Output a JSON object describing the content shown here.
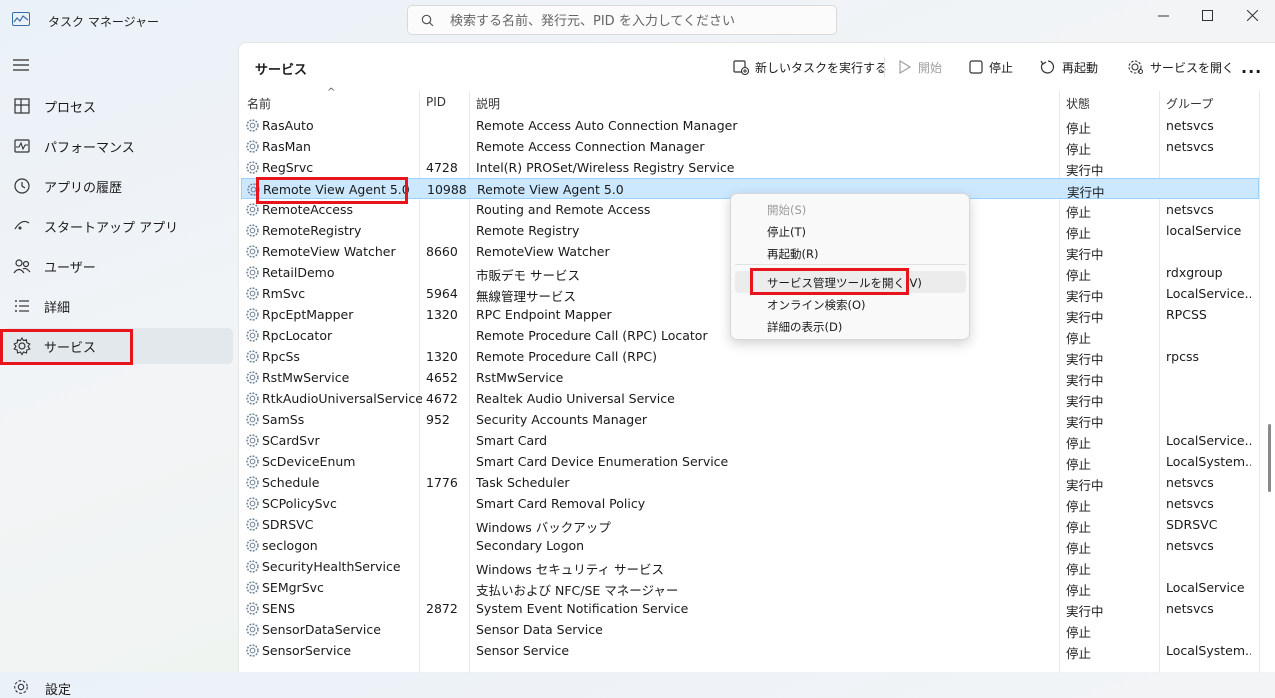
{
  "window": {
    "title": "タスク マネージャー",
    "search_placeholder": "検索する名前、発行元、PID を入力してください"
  },
  "sidebar": {
    "items": [
      {
        "label": "プロセス",
        "icon": "processes-icon"
      },
      {
        "label": "パフォーマンス",
        "icon": "performance-icon"
      },
      {
        "label": "アプリの履歴",
        "icon": "history-icon"
      },
      {
        "label": "スタートアップ アプリ",
        "icon": "startup-icon"
      },
      {
        "label": "ユーザー",
        "icon": "users-icon"
      },
      {
        "label": "詳細",
        "icon": "details-icon"
      },
      {
        "label": "サービス",
        "icon": "services-icon",
        "active": true
      }
    ],
    "settings_label": "設定"
  },
  "toolbar": {
    "page_title": "サービス",
    "new_task": "新しいタスクを実行する",
    "start": "開始",
    "stop": "停止",
    "restart": "再起動",
    "open_services": "サービスを開く",
    "more": "..."
  },
  "table": {
    "headers": {
      "name": "名前",
      "pid": "PID",
      "desc": "説明",
      "status": "状態",
      "group": "グループ"
    },
    "rows": [
      {
        "name": "RasAuto",
        "pid": "",
        "desc": "Remote Access Auto Connection Manager",
        "status": "停止",
        "group": "netsvcs"
      },
      {
        "name": "RasMan",
        "pid": "",
        "desc": "Remote Access Connection Manager",
        "status": "停止",
        "group": "netsvcs"
      },
      {
        "name": "RegSrvc",
        "pid": "4728",
        "desc": "Intel(R) PROSet/Wireless Registry Service",
        "status": "実行中",
        "group": ""
      },
      {
        "name": "Remote View Agent 5.0",
        "pid": "10988",
        "desc": "Remote View Agent 5.0",
        "status": "実行中",
        "group": "",
        "selected": true
      },
      {
        "name": "RemoteAccess",
        "pid": "",
        "desc": "Routing and Remote Access",
        "status": "停止",
        "group": "netsvcs"
      },
      {
        "name": "RemoteRegistry",
        "pid": "",
        "desc": "Remote Registry",
        "status": "停止",
        "group": "localService"
      },
      {
        "name": "RemoteView Watcher",
        "pid": "8660",
        "desc": "RemoteView Watcher",
        "status": "実行中",
        "group": ""
      },
      {
        "name": "RetailDemo",
        "pid": "",
        "desc": "市販デモ サービス",
        "status": "停止",
        "group": "rdxgroup"
      },
      {
        "name": "RmSvc",
        "pid": "5964",
        "desc": "無線管理サービス",
        "status": "実行中",
        "group": "LocalService..."
      },
      {
        "name": "RpcEptMapper",
        "pid": "1320",
        "desc": "RPC Endpoint Mapper",
        "status": "実行中",
        "group": "RPCSS"
      },
      {
        "name": "RpcLocator",
        "pid": "",
        "desc": "Remote Procedure Call (RPC) Locator",
        "status": "停止",
        "group": ""
      },
      {
        "name": "RpcSs",
        "pid": "1320",
        "desc": "Remote Procedure Call (RPC)",
        "status": "実行中",
        "group": "rpcss"
      },
      {
        "name": "RstMwService",
        "pid": "4652",
        "desc": "RstMwService",
        "status": "実行中",
        "group": ""
      },
      {
        "name": "RtkAudioUniversalService",
        "pid": "4672",
        "desc": "Realtek Audio Universal Service",
        "status": "実行中",
        "group": ""
      },
      {
        "name": "SamSs",
        "pid": "952",
        "desc": "Security Accounts Manager",
        "status": "実行中",
        "group": ""
      },
      {
        "name": "SCardSvr",
        "pid": "",
        "desc": "Smart Card",
        "status": "停止",
        "group": "LocalService..."
      },
      {
        "name": "ScDeviceEnum",
        "pid": "",
        "desc": "Smart Card Device Enumeration Service",
        "status": "停止",
        "group": "LocalSystem..."
      },
      {
        "name": "Schedule",
        "pid": "1776",
        "desc": "Task Scheduler",
        "status": "実行中",
        "group": "netsvcs"
      },
      {
        "name": "SCPolicySvc",
        "pid": "",
        "desc": "Smart Card Removal Policy",
        "status": "停止",
        "group": "netsvcs"
      },
      {
        "name": "SDRSVC",
        "pid": "",
        "desc": "Windows バックアップ",
        "status": "停止",
        "group": "SDRSVC"
      },
      {
        "name": "seclogon",
        "pid": "",
        "desc": "Secondary Logon",
        "status": "停止",
        "group": "netsvcs"
      },
      {
        "name": "SecurityHealthService",
        "pid": "",
        "desc": "Windows セキュリティ サービス",
        "status": "停止",
        "group": ""
      },
      {
        "name": "SEMgrSvc",
        "pid": "",
        "desc": "支払いおよび NFC/SE マネージャー",
        "status": "停止",
        "group": "LocalService"
      },
      {
        "name": "SENS",
        "pid": "2872",
        "desc": "System Event Notification Service",
        "status": "実行中",
        "group": "netsvcs"
      },
      {
        "name": "SensorDataService",
        "pid": "",
        "desc": "Sensor Data Service",
        "status": "停止",
        "group": ""
      },
      {
        "name": "SensorService",
        "pid": "",
        "desc": "Sensor Service",
        "status": "停止",
        "group": "LocalSystem..."
      }
    ]
  },
  "context_menu": {
    "items": [
      {
        "label": "開始(S)",
        "disabled": true
      },
      {
        "label": "停止(T)"
      },
      {
        "label": "再起動(R)"
      },
      {
        "label": "サービス管理ツールを開く(V)",
        "hover": true
      },
      {
        "label": "オンライン検索(O)"
      },
      {
        "label": "詳細の表示(D)"
      }
    ]
  },
  "colors": {
    "highlight": "#e8141b",
    "selection": "#cce8ff",
    "accent": "#0067c0"
  }
}
